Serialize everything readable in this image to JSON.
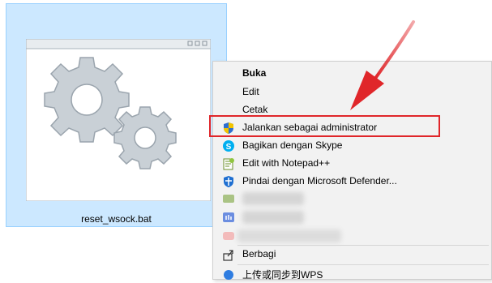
{
  "file": {
    "name": "reset_wsock.bat"
  },
  "context_menu": {
    "items": [
      {
        "label": "Buka",
        "bold": true,
        "icon": ""
      },
      {
        "label": "Edit",
        "icon": ""
      },
      {
        "label": "Cetak",
        "icon": ""
      },
      {
        "label": "Jalankan sebagai administrator",
        "icon": "shield-icon"
      },
      {
        "label": "Bagikan dengan Skype",
        "icon": "skype-icon"
      },
      {
        "label": "Edit with Notepad++",
        "icon": "notepadpp-icon"
      },
      {
        "label": "Pindai dengan Microsoft Defender...",
        "icon": "defender-icon"
      },
      {
        "label": "",
        "icon": "blurred-app-icon"
      },
      {
        "label": "",
        "icon": "blurred-app-icon"
      },
      {
        "label": "",
        "icon": "blurred-app-icon"
      },
      {
        "label": "Berbagi",
        "icon": "share-icon"
      },
      {
        "label": "上传或同步到WPS",
        "icon": "wps-cloud-icon"
      }
    ]
  },
  "colors": {
    "selection_bg": "#cce8ff",
    "selection_border": "#99d1ff",
    "highlight": "#e0262a",
    "arrow": "#e0262a",
    "menu_bg": "#f2f2f2"
  }
}
